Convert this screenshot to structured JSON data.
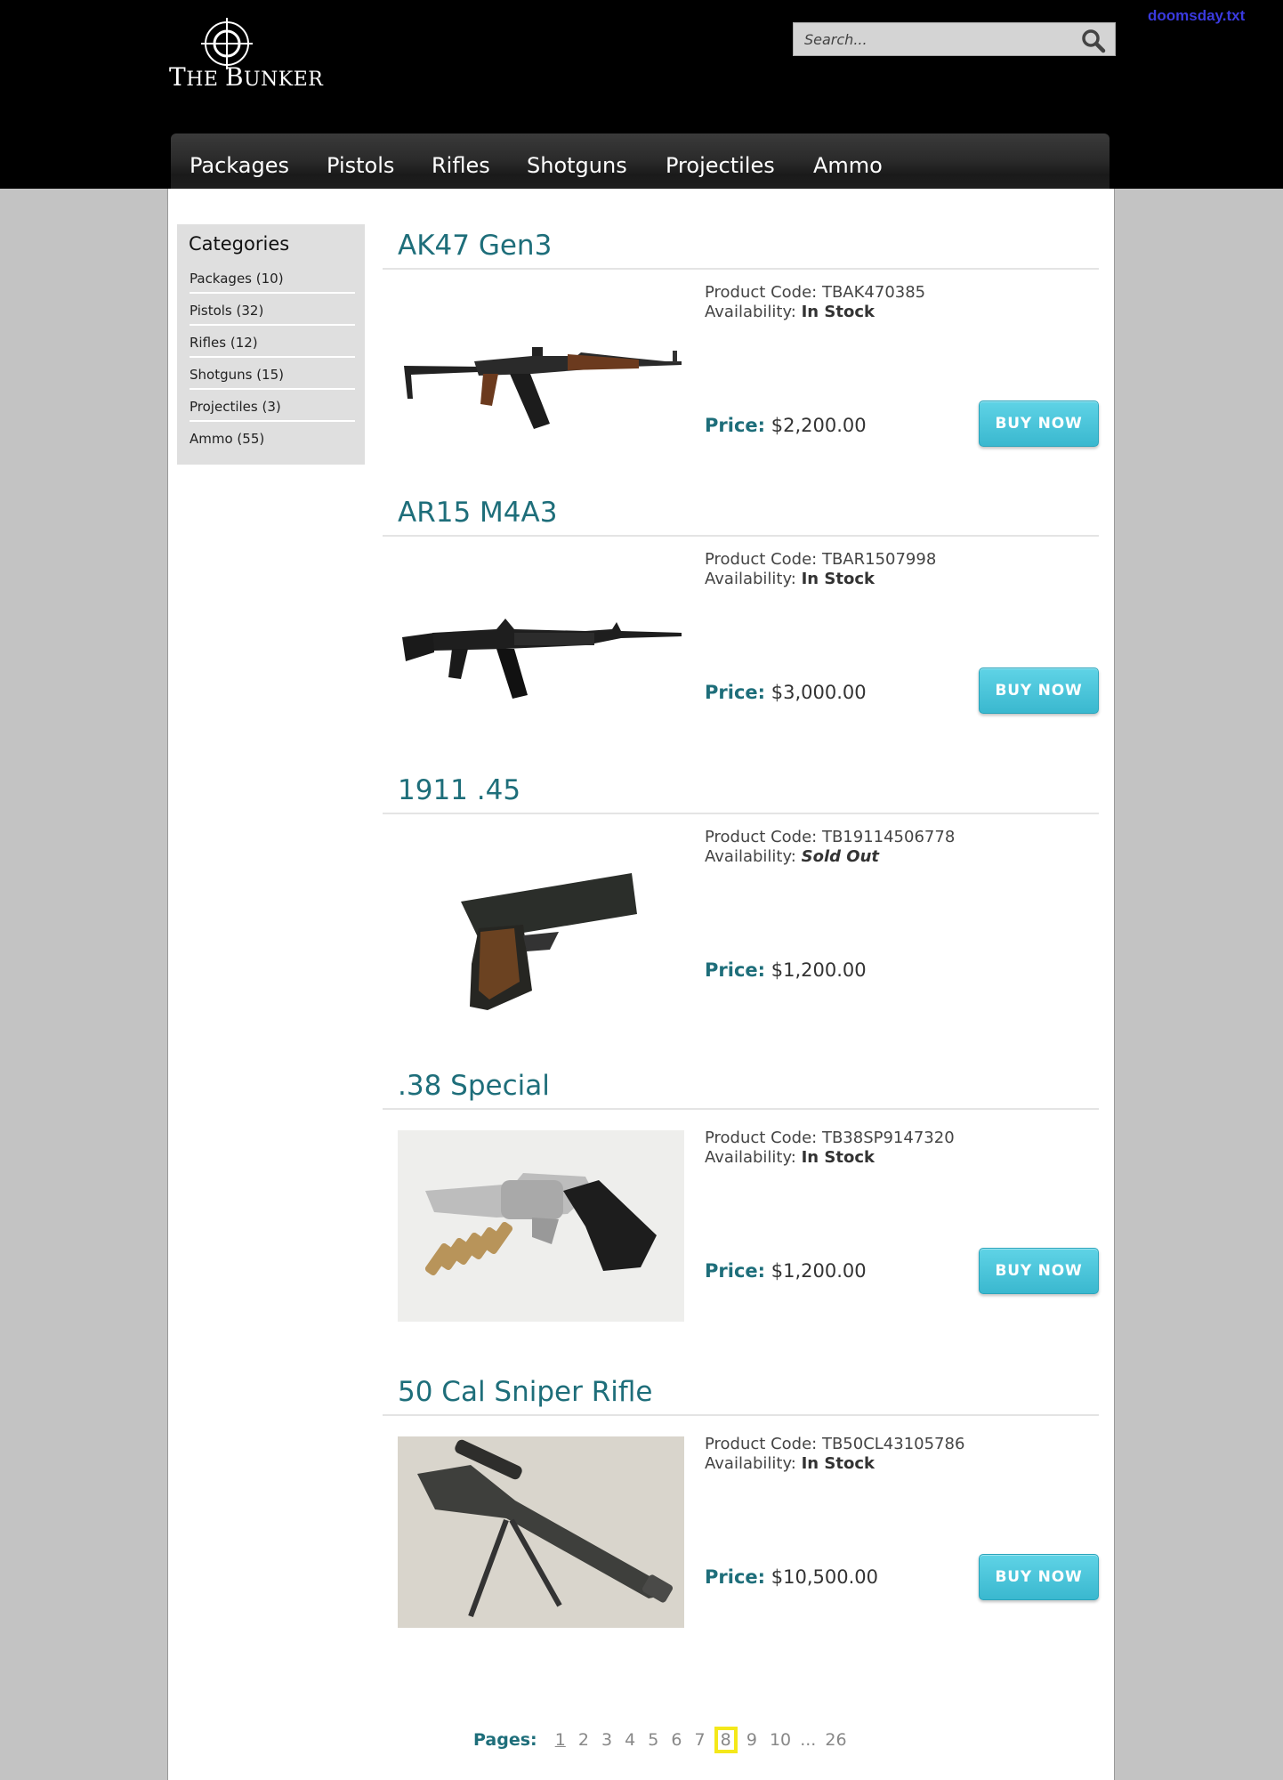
{
  "site": {
    "logo_big": "T",
    "logo_text": "HE ",
    "logo_big2": "B",
    "logo_text2": "UNKER",
    "top_link": "doomsday.txt"
  },
  "search": {
    "placeholder": "Search..."
  },
  "nav": [
    "Packages",
    "Pistols",
    "Rifles",
    "Shotguns",
    "Projectiles",
    "Ammo"
  ],
  "sidebar": {
    "title": "Categories",
    "items": [
      "Packages (10)",
      "Pistols (32)",
      "Rifles (12)",
      "Shotguns (15)",
      "Projectiles (3)",
      "Ammo (55)"
    ]
  },
  "labels": {
    "product_code": "Product Code:",
    "availability": "Availability:",
    "price": "Price:",
    "buy": "BUY NOW"
  },
  "products": [
    {
      "title": "AK47 Gen3",
      "code": "TBAK470385",
      "availability": "In Stock",
      "price": "$2,200.00",
      "image": "ak47-rifle",
      "buy": true
    },
    {
      "title": "AR15 M4A3",
      "code": "TBAR1507998",
      "availability": "In Stock",
      "price": "$3,000.00",
      "image": "ar15-rifle",
      "buy": true
    },
    {
      "title": "1911 .45",
      "code": "TB19114506778",
      "availability": "Sold Out",
      "price": "$1,200.00",
      "image": "1911-pistol",
      "buy": false
    },
    {
      "title": ".38 Special",
      "code": "TB38SP9147320",
      "availability": "In Stock",
      "price": "$1,200.00",
      "image": "revolver-photo",
      "buy": true
    },
    {
      "title": "50 Cal Sniper Rifle",
      "code": "TB50CL43105786",
      "availability": "In Stock",
      "price": "$10,500.00",
      "image": "sniper-photo",
      "buy": true
    }
  ],
  "pager": {
    "label": "Pages:",
    "pages": [
      "1",
      "2",
      "3",
      "4",
      "5",
      "6",
      "7",
      "8",
      "9",
      "10"
    ],
    "current": "8",
    "ellipsis": "...",
    "last": "26"
  }
}
